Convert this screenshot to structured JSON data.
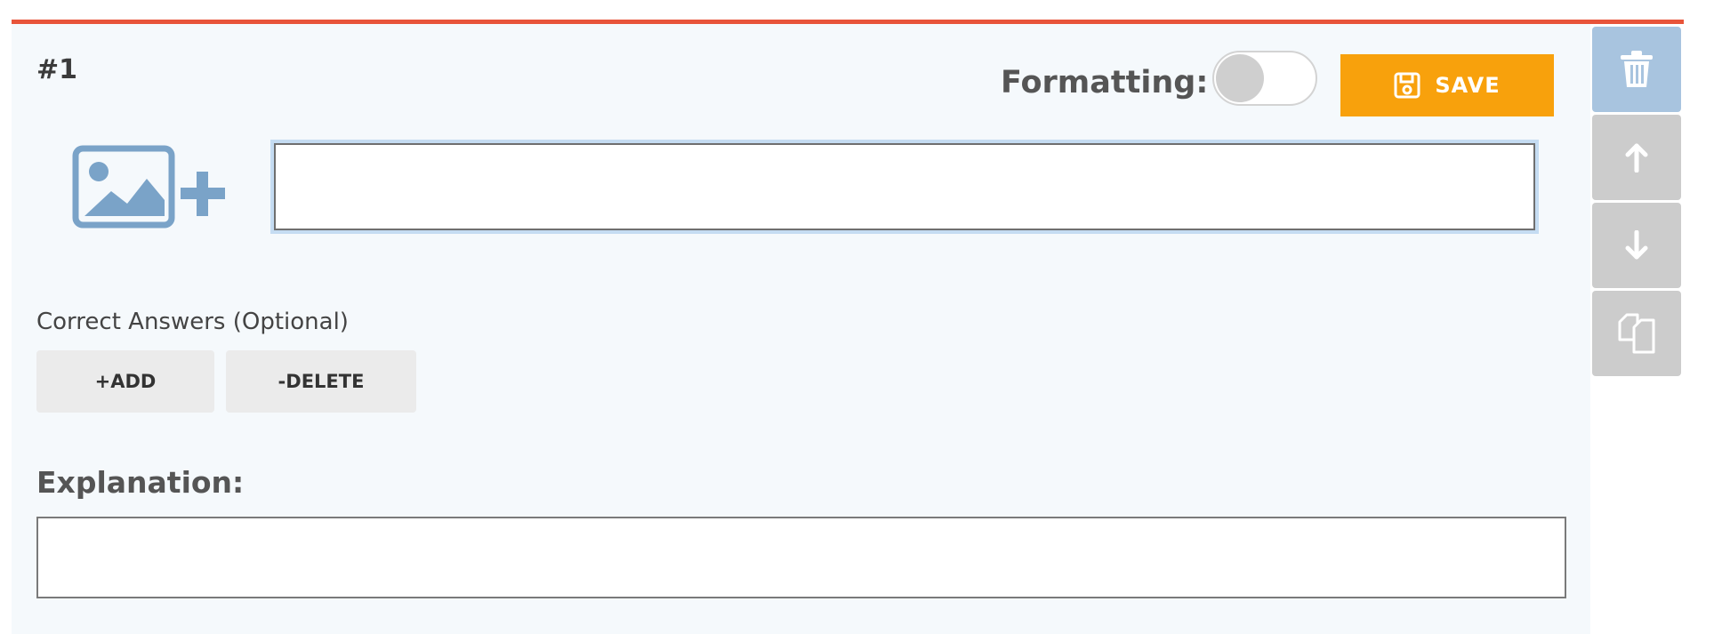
{
  "question": {
    "number": "#1",
    "formatting_label": "Formatting:",
    "formatting_enabled": false,
    "save_label": "SAVE",
    "question_text": "",
    "image_icon": "add-image-icon"
  },
  "answers": {
    "label": "Correct Answers (Optional)",
    "add_label": "+ADD",
    "delete_label": "-DELETE"
  },
  "explanation": {
    "label": "Explanation:",
    "value": ""
  },
  "side_toolbar": {
    "items": [
      {
        "icon": "trash-icon",
        "color": "#a8c4df"
      },
      {
        "icon": "arrow-up-icon",
        "color": "#cccccc"
      },
      {
        "icon": "arrow-down-icon",
        "color": "#cccccc"
      },
      {
        "icon": "copy-icon",
        "color": "#cccccc"
      }
    ]
  },
  "colors": {
    "accent_rule": "#e8543a",
    "save_button": "#f8a10c",
    "image_icon": "#7aa3c8",
    "card_background": "#f5f9fc"
  }
}
